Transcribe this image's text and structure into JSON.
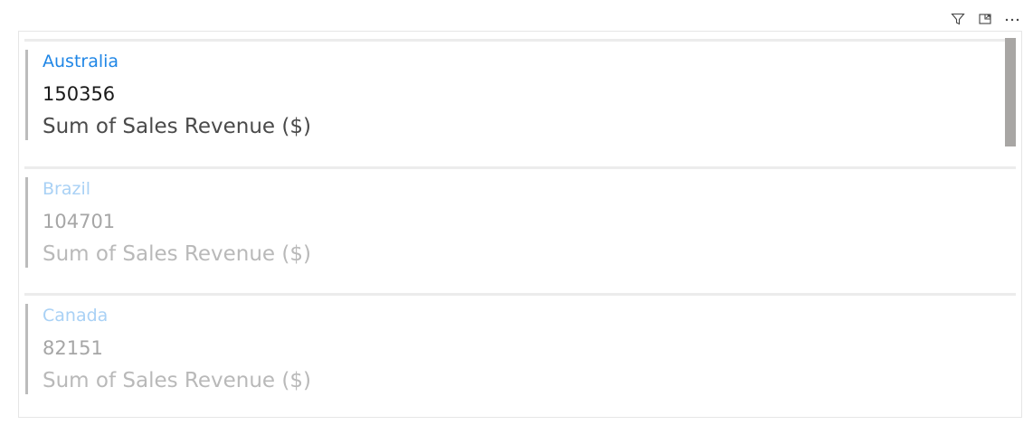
{
  "header": {
    "icons": [
      "filter-icon",
      "focus-mode-icon",
      "more-options-icon"
    ],
    "more_label": "···"
  },
  "cards": [
    {
      "title": "Australia",
      "value": "150356",
      "label": "Sum of Sales Revenue ($)",
      "state": "active"
    },
    {
      "title": "Brazil",
      "value": "104701",
      "label": "Sum of Sales Revenue ($)",
      "state": "dimmed"
    },
    {
      "title": "Canada",
      "value": "82151",
      "label": "Sum of Sales Revenue ($)",
      "state": "dimmed"
    }
  ],
  "colors": {
    "title_active": "#1f86e6",
    "title_dimmed": "#a9d1f5",
    "accent_bar": "#bcbcbc",
    "scrollbar_thumb": "#a8a6a4"
  }
}
